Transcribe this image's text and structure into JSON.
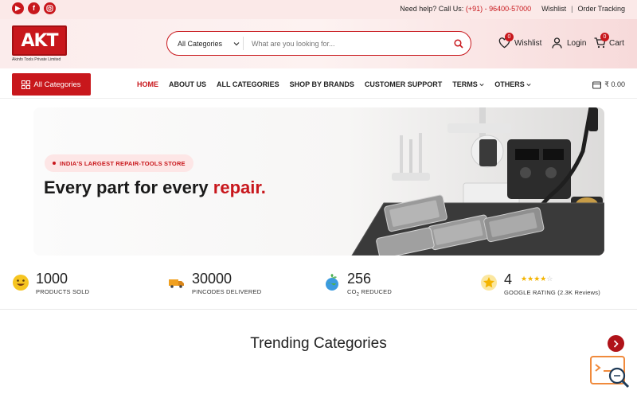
{
  "topbar": {
    "social": [
      "youtube-icon",
      "facebook-icon",
      "instagram-icon"
    ],
    "help_label": "Need help? Call Us:",
    "phone": "(+91) - 96400-57000",
    "wishlist": "Wishlist",
    "separator": "|",
    "order_tracking": "Order Tracking"
  },
  "header": {
    "logo_text": "AKT",
    "logo_sub": "Akinfo Tools Private Limited",
    "search_category": "All Categories",
    "search_placeholder": "What are you looking for...",
    "wishlist_label": "Wishlist",
    "wishlist_count": "0",
    "login_label": "Login",
    "cart_label": "Cart",
    "cart_count": "0"
  },
  "nav": {
    "all_categories": "All Categories",
    "items": [
      "HOME",
      "ABOUT US",
      "ALL CATEGORIES",
      "SHOP BY BRANDS",
      "CUSTOMER SUPPORT",
      "TERMS",
      "OTHERS"
    ],
    "cart_value": "₹ 0.00"
  },
  "hero": {
    "tag": "INDIA'S LARGEST REPAIR-TOOLS STORE",
    "headline_prefix": "Every part for every ",
    "headline_highlight": "repair."
  },
  "stats": [
    {
      "value": "1000",
      "label": "PRODUCTS SOLD",
      "icon": "smiley-icon"
    },
    {
      "value": "30000",
      "label": "PINCODES DELIVERED",
      "icon": "truck-icon"
    },
    {
      "value": "256",
      "label_prefix": "CO",
      "label_sub": "2",
      "label_suffix": " REDUCED",
      "icon": "globe-leaf-icon"
    },
    {
      "value": "4",
      "label": "GOOGLE RATING (2.3K Reviews)",
      "icon": "star-badge-icon",
      "rating": 4
    }
  ],
  "trending": {
    "title": "Trending Categories"
  },
  "colors": {
    "brand_red": "#c8171c",
    "text_dark": "#222222",
    "pink_bg": "#fbe9e8"
  }
}
